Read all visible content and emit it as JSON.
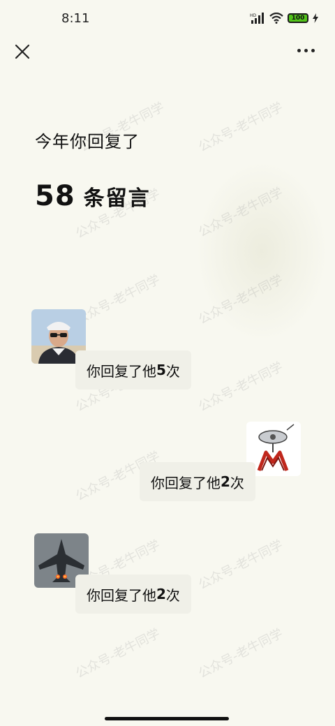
{
  "status_bar": {
    "time": "8:11",
    "battery": "100",
    "hd_label": "HD"
  },
  "heading": "今年你回复了",
  "stat": {
    "count": "58",
    "unit": "条留言"
  },
  "replies": [
    {
      "prefix": "你回复了他",
      "count": "5",
      "suffix": "次"
    },
    {
      "prefix": "你回复了他",
      "count": "2",
      "suffix": "次"
    },
    {
      "prefix": "你回复了他",
      "count": "2",
      "suffix": "次"
    }
  ],
  "watermark": "公众号-老牛同学",
  "colors": {
    "background": "#f8f8f0",
    "bubble": "#f0f0e8",
    "battery_fill": "#52c41a"
  }
}
